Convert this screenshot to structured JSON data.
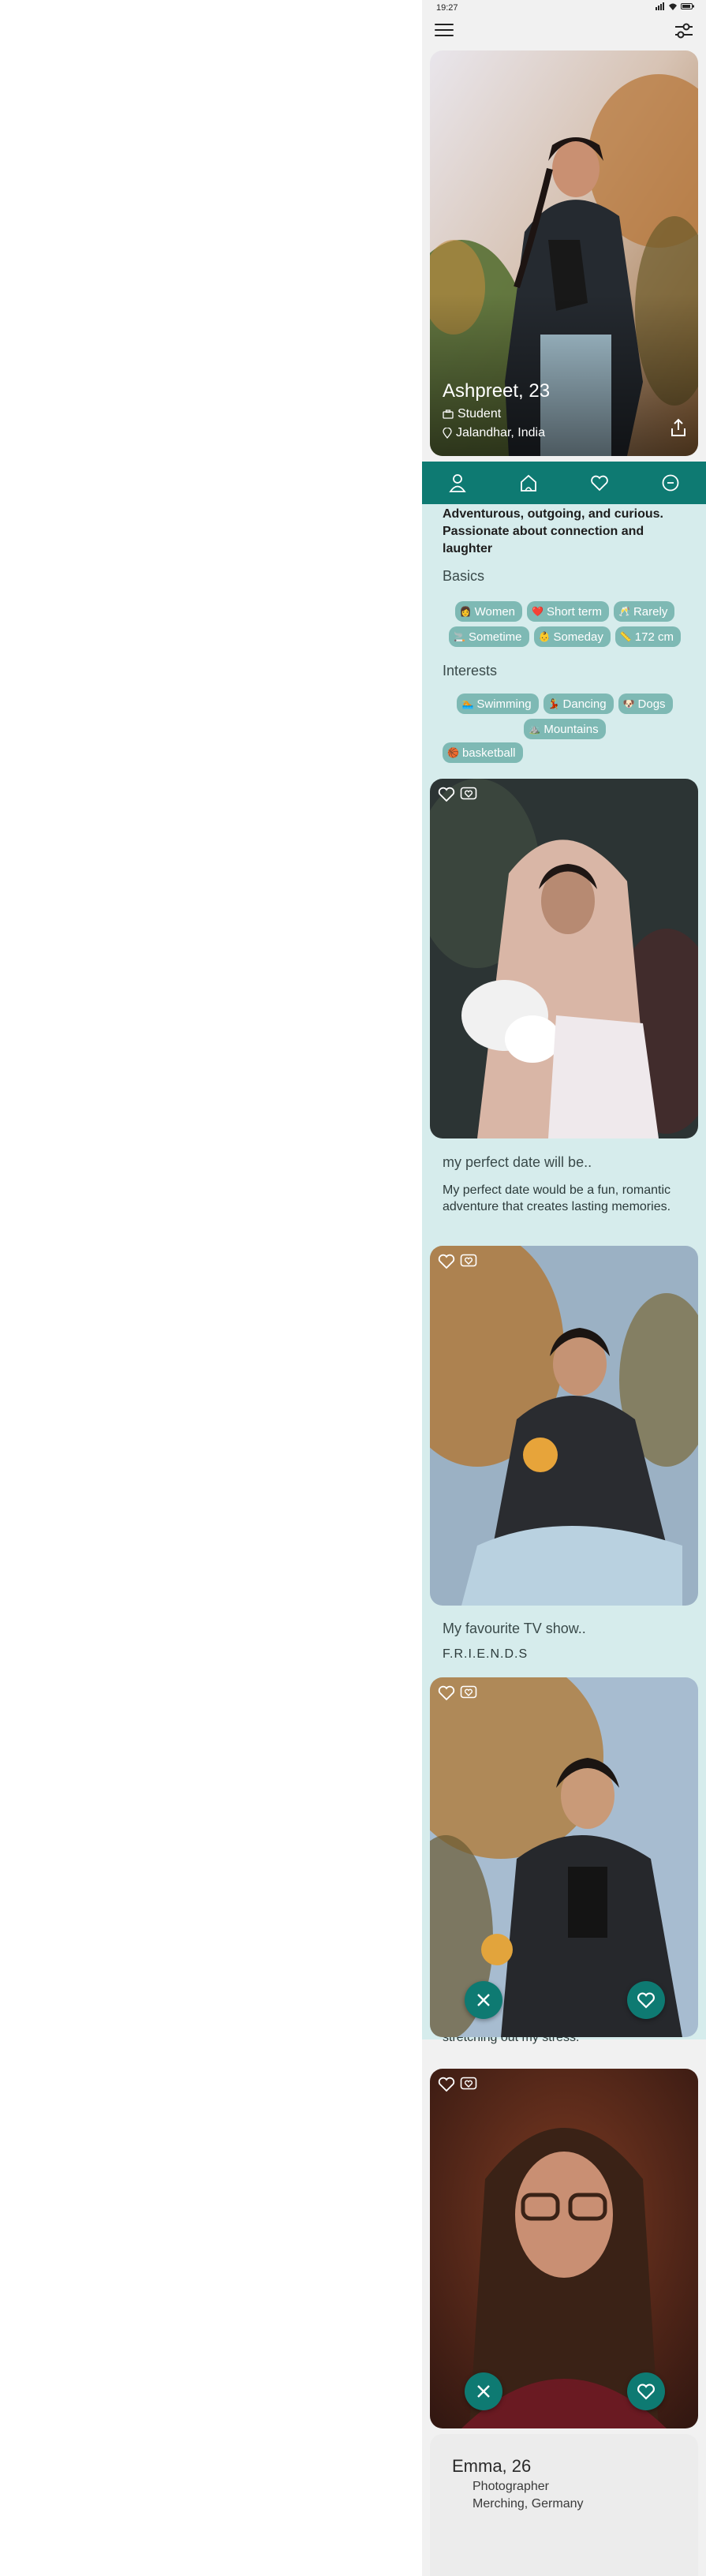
{
  "status": {
    "time": "19:27"
  },
  "profile": {
    "name": "Ashpreet, 23",
    "occupation": "Student",
    "location": "Jalandhar, India",
    "bio": "Adventurous, outgoing, and curious. Passionate about connection and laughter"
  },
  "basics": {
    "title": "Basics",
    "chips": [
      {
        "emoji": "👩",
        "label": "Women"
      },
      {
        "emoji": "❤️",
        "label": "Short term"
      },
      {
        "emoji": "🥂",
        "label": "Rarely"
      },
      {
        "emoji": "🚬",
        "label": "Sometime"
      },
      {
        "emoji": "👶",
        "label": "Someday"
      },
      {
        "emoji": "📏",
        "label": "172 cm"
      }
    ]
  },
  "interests": {
    "title": "Interests",
    "chips": [
      {
        "emoji": "🏊",
        "label": "Swimming"
      },
      {
        "emoji": "💃",
        "label": "Dancing"
      },
      {
        "emoji": "🐶",
        "label": "Dogs"
      },
      {
        "emoji": "⛰️",
        "label": "Mountains"
      },
      {
        "emoji": "🏀",
        "label": "basketball"
      }
    ]
  },
  "prompts": [
    {
      "question": "my perfect date will be..",
      "answer": "My perfect date would be a fun, romantic adventure that creates lasting memories."
    },
    {
      "question": "My favourite TV show..",
      "answer": "F.R.I.E.N.D.S"
    }
  ],
  "partial_text": "stretching out my stress.",
  "next_profile": {
    "name": "Emma, 26",
    "occupation": "Photographer",
    "location": "Merching, Germany"
  },
  "icons": {
    "menu": "hamburger-icon",
    "filter": "filter-icon",
    "share": "share-icon",
    "nav": [
      "profile-icon",
      "home-icon",
      "heart-icon",
      "chat-icon"
    ],
    "like": "heart-outline-icon",
    "superlike": "heart-chat-icon"
  },
  "colors": {
    "accent": "#0e7a72",
    "panel": "#d6ecec",
    "chip": "#7eb9b4"
  }
}
